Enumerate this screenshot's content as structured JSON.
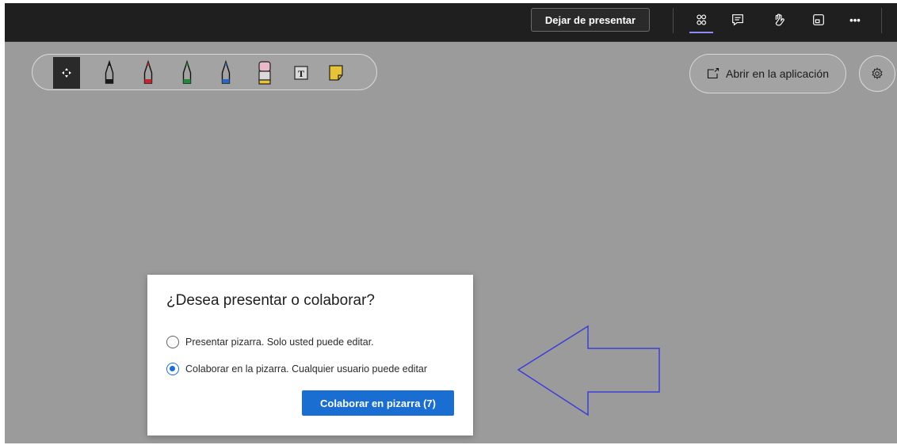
{
  "topbar": {
    "stop_presenting_label": "Dejar de presentar",
    "icons": [
      "participants-icon",
      "chat-icon",
      "raise-hand-icon",
      "view-icon",
      "more-icon"
    ],
    "more_glyph": "•••"
  },
  "pen_toolbar": {
    "tools": [
      {
        "name": "move-tool",
        "icon": "move-icon"
      },
      {
        "name": "black-pen",
        "icon": "pen-icon",
        "color": "#1a1a1a"
      },
      {
        "name": "red-pen",
        "icon": "pen-icon",
        "color": "#c4262e"
      },
      {
        "name": "green-pen",
        "icon": "pen-icon",
        "color": "#1f8b3a"
      },
      {
        "name": "blue-pen",
        "icon": "pen-icon",
        "color": "#2a66c4"
      },
      {
        "name": "eraser",
        "icon": "eraser-icon",
        "color": "#e8b9c9"
      },
      {
        "name": "text-tool",
        "icon": "text-box-icon",
        "glyph": "T"
      },
      {
        "name": "sticky-note",
        "icon": "sticky-note-icon",
        "color": "#e8c33a"
      }
    ]
  },
  "open_in_app": {
    "label": "Abrir en la aplicación",
    "icon": "open-external-icon"
  },
  "settings": {
    "icon": "gear-icon"
  },
  "dialog": {
    "title": "¿Desea presentar o colaborar?",
    "options": [
      {
        "label": "Presentar pizarra. Solo usted puede editar.",
        "checked": false
      },
      {
        "label": "Colaborar en la pizarra. Cualquier usuario puede editar",
        "checked": true
      }
    ],
    "primary_button": "Colaborar en pizarra (7)"
  },
  "annotation": {
    "icon": "left-arrow-outline",
    "color": "#3b3fd6"
  },
  "colors": {
    "accent": "#1a6ed1",
    "topbar": "#1f1f1f",
    "canvas": "#9b9b9b"
  }
}
